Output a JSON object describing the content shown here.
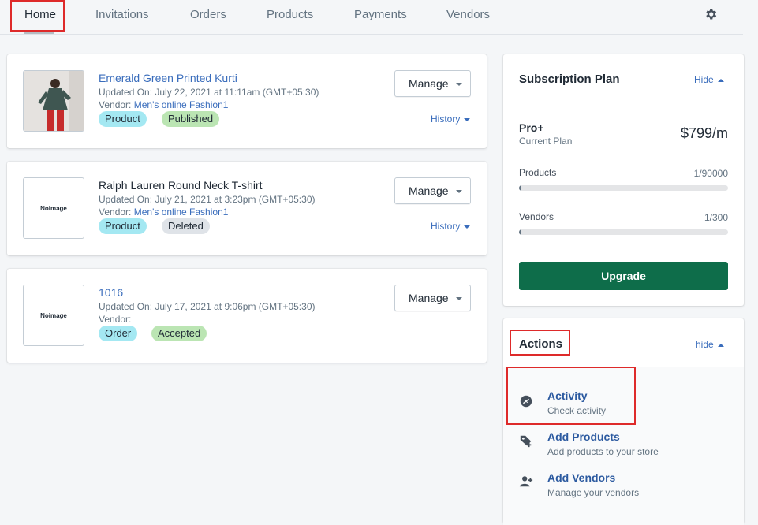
{
  "nav": {
    "tabs": [
      "Home",
      "Invitations",
      "Orders",
      "Products",
      "Payments",
      "Vendors"
    ],
    "active_tab": "Home",
    "settings_icon": "gear-icon"
  },
  "feed": [
    {
      "title": "Emerald Green Printed Kurti",
      "title_is_link": true,
      "has_image": true,
      "no_image_label": "",
      "updated": "Updated On: July 22, 2021 at 11:11am (GMT+05:30)",
      "vendor_label": "Vendor:",
      "vendor_name": "Men's online Fashion1",
      "badges": [
        {
          "text": "Product",
          "color": "#a4e8f2"
        },
        {
          "text": "Published",
          "color": "#bbe5b3"
        }
      ],
      "manage_label": "Manage",
      "history_label": "History"
    },
    {
      "title": "Ralph Lauren Round Neck T-shirt",
      "title_is_link": false,
      "has_image": false,
      "no_image_label": "Noimage",
      "updated": "Updated On: July 21, 2021 at 3:23pm (GMT+05:30)",
      "vendor_label": "Vendor:",
      "vendor_name": "Men's online Fashion1",
      "badges": [
        {
          "text": "Product",
          "color": "#a4e8f2"
        },
        {
          "text": "Deleted",
          "color": "#dfe3e8"
        }
      ],
      "manage_label": "Manage",
      "history_label": "History"
    },
    {
      "title": "1016",
      "title_is_link": true,
      "has_image": false,
      "no_image_label": "Noimage",
      "updated": "Updated On: July 17, 2021 at 9:06pm (GMT+05:30)",
      "vendor_label": "Vendor:",
      "vendor_name": "",
      "badges": [
        {
          "text": "Order",
          "color": "#a4e8f2"
        },
        {
          "text": "Accepted",
          "color": "#bbe5b3"
        }
      ],
      "manage_label": "Manage",
      "history_label": ""
    }
  ],
  "subscription": {
    "title": "Subscription Plan",
    "hide_label": "Hide",
    "plan_name": "Pro+",
    "plan_caption": "Current Plan",
    "price": "$799/m",
    "products_label": "Products",
    "products_usage": "1/90000",
    "products_fraction": 1e-05,
    "vendors_label": "Vendors",
    "vendors_usage": "1/300",
    "vendors_fraction": 0.0033,
    "upgrade_label": "Upgrade"
  },
  "actions": {
    "title": "Actions",
    "hide_label": "hide",
    "items": [
      {
        "title": "Activity",
        "desc": "Check activity",
        "icon": "activity-icon"
      },
      {
        "title": "Add Products",
        "desc": "Add products to your store",
        "icon": "add-tag-icon"
      },
      {
        "title": "Add Vendors",
        "desc": "Manage your vendors",
        "icon": "add-user-icon"
      }
    ]
  },
  "colors": {
    "link": "#3a6dbc",
    "primary_button": "#0e6d4a",
    "highlight_box": "#de2a2a"
  }
}
